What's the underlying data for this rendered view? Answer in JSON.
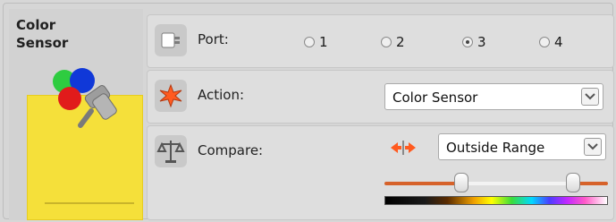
{
  "block": {
    "title": "Color\nSensor",
    "card_color": "#f5e03a"
  },
  "port": {
    "label": "Port:",
    "options": [
      "1",
      "2",
      "3",
      "4"
    ],
    "selected": "3",
    "icon": "port-connector-icon"
  },
  "action": {
    "label": "Action:",
    "value": "Color Sensor",
    "icon": "starburst-action-icon"
  },
  "compare": {
    "label": "Compare:",
    "value": "Outside Range",
    "icon": "scale-compare-icon",
    "range_icon": "range-arrows-icon"
  },
  "range": {
    "track_color": "#d6622a",
    "spectrum": [
      "#000000",
      "#5a2b00",
      "#f0a000",
      "#ffff00",
      "#3bdc3b",
      "#00d8ff",
      "#4b3cff",
      "#c227ff",
      "#ff5ac8",
      "#ffffff"
    ]
  }
}
